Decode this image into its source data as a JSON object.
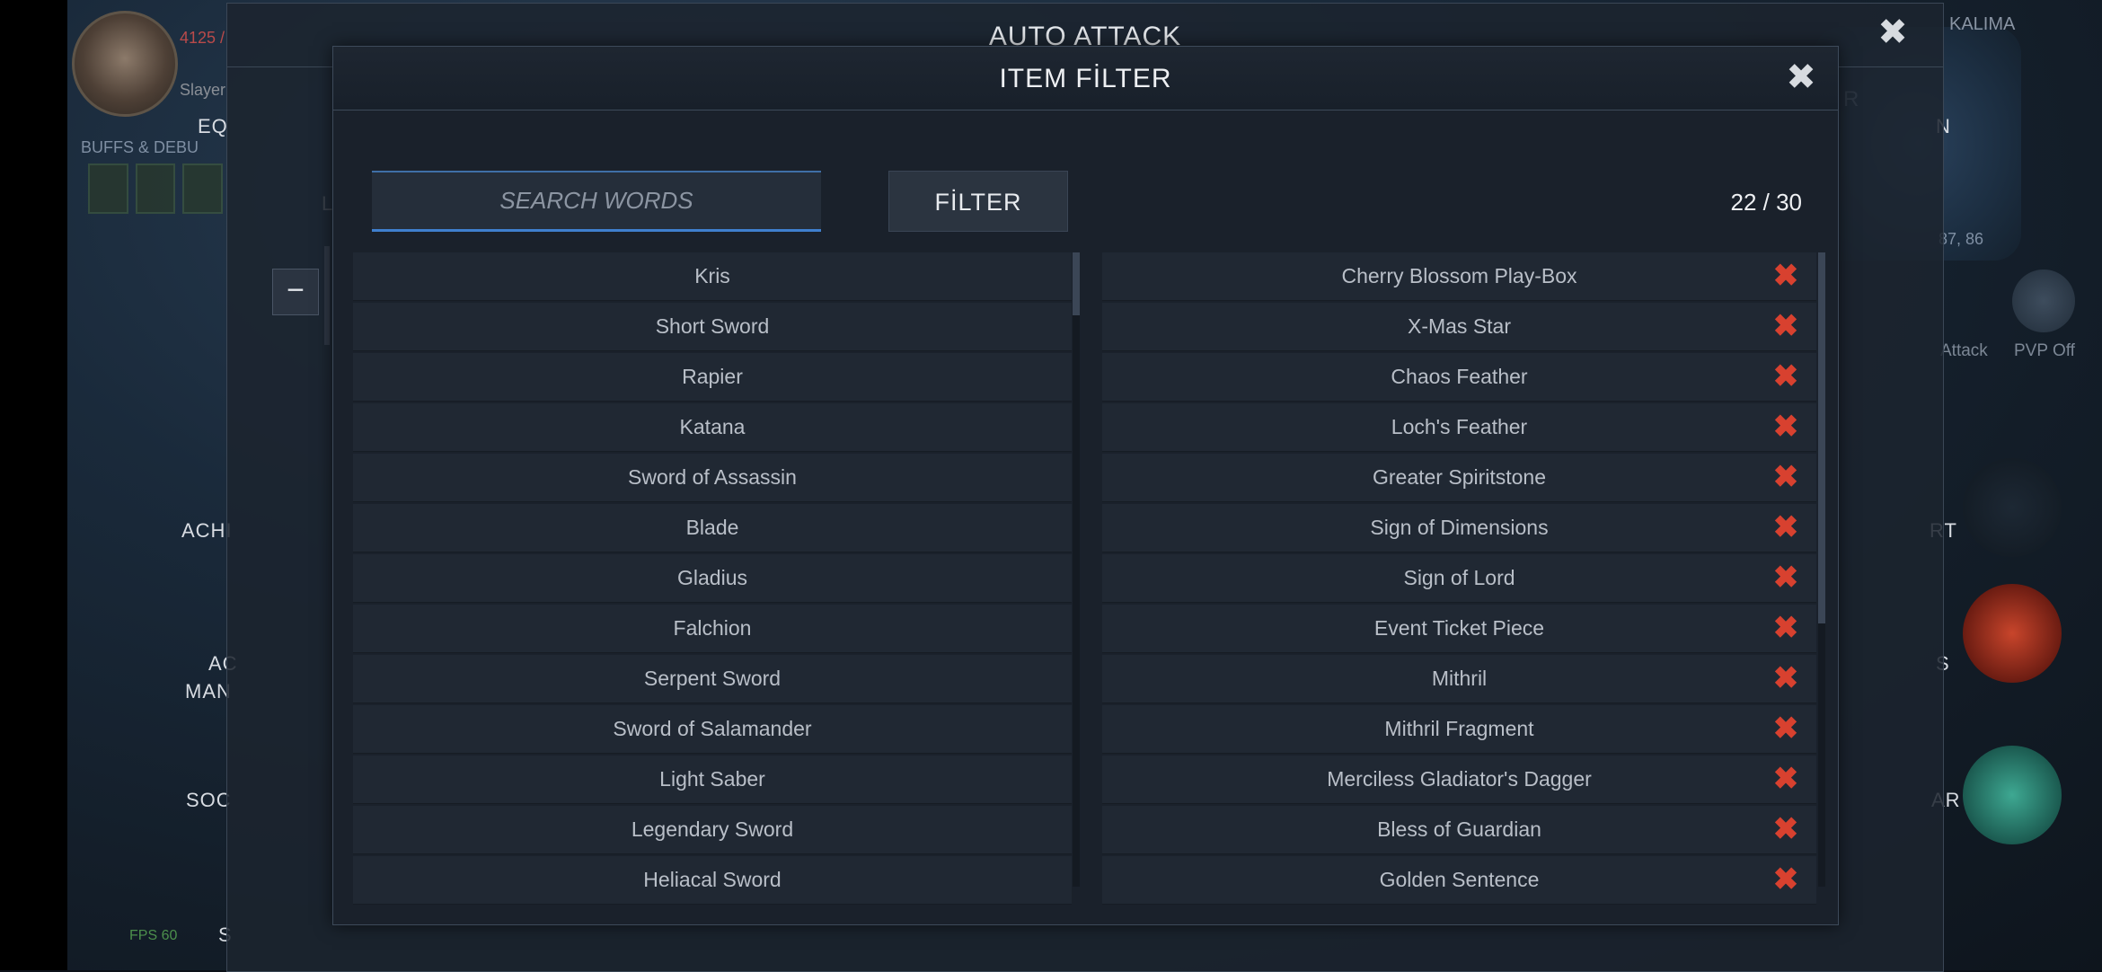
{
  "background": {
    "hp_text": "4125 /",
    "class_text": "Slayer",
    "buffs_label": "BUFFS & DEBU",
    "equip_label": "EQ",
    "l_label": "L",
    "achi_label": "ACHI",
    "ac_label": "AC",
    "man_label": "MAN",
    "soc_label": "SOC",
    "s_label": "S",
    "kalima_label": "KALIMA",
    "n_label": "N",
    "coords_label": "87, 86",
    "attack_label": "Attack",
    "pvp_label": "PVP Off",
    "rt_label": "RT",
    "s_right_label": "S",
    "ar_label": "AR",
    "fps_label": "FPS 60",
    "r_label": "R"
  },
  "outer_panel": {
    "title": "AUTO ATTACK",
    "close_icon": "close-icon",
    "minus_label": "−"
  },
  "item_filter": {
    "title": "ITEM FİLTER",
    "search_placeholder": "SEARCH WORDS",
    "search_value": "",
    "filter_button": "FİLTER",
    "count": "22 / 30",
    "available_items": [
      "Kris",
      "Short Sword",
      "Rapier",
      "Katana",
      "Sword of Assassin",
      "Blade",
      "Gladius",
      "Falchion",
      "Serpent Sword",
      "Sword of Salamander",
      "Light Saber",
      "Legendary Sword",
      "Heliacal Sword"
    ],
    "filtered_items": [
      "Cherry Blossom Play-Box",
      "X-Mas Star",
      "Chaos Feather",
      "Loch's Feather",
      "Greater Spiritstone",
      "Sign of Dimensions",
      "Sign of Lord",
      "Event Ticket Piece",
      "Mithril",
      "Mithril Fragment",
      "Merciless Gladiator's Dagger",
      "Bless of Guardian",
      "Golden Sentence"
    ],
    "remove_icon": "✖"
  },
  "colors": {
    "accent_blue": "#3f7fce",
    "remove_red": "#d8412f",
    "panel_bg": "#1a212b",
    "row_bg": "#202833"
  }
}
